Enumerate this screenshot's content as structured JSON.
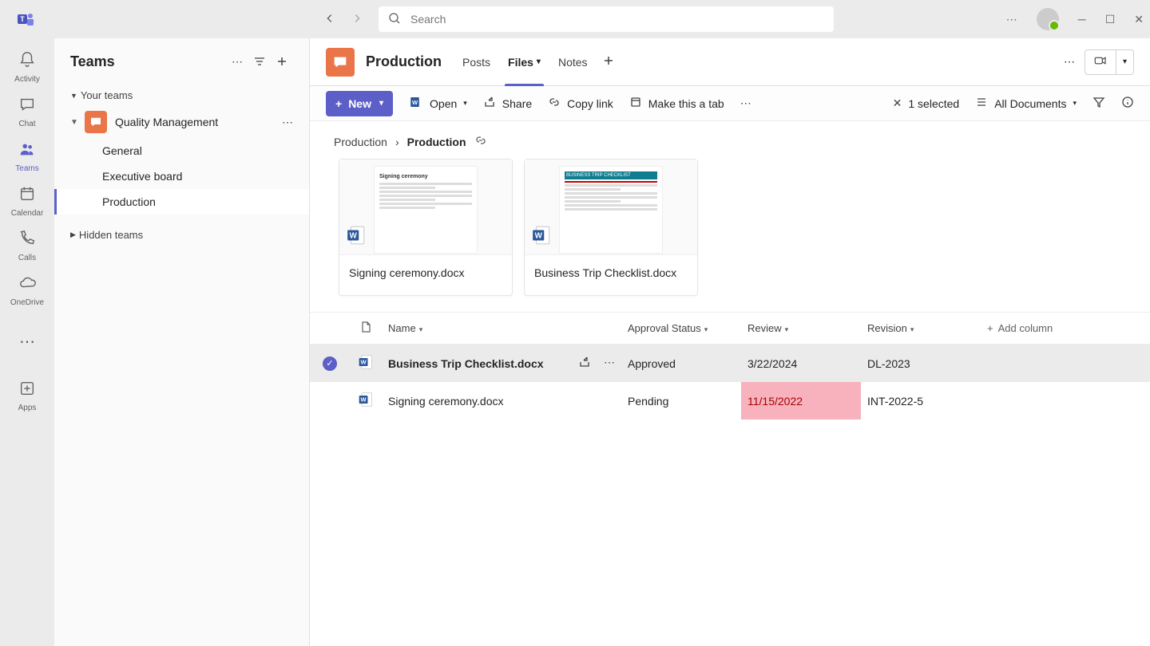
{
  "search_placeholder": "Search",
  "app_rail": [
    {
      "id": "activity",
      "label": "Activity"
    },
    {
      "id": "chat",
      "label": "Chat"
    },
    {
      "id": "teams",
      "label": "Teams",
      "active": true
    },
    {
      "id": "calendar",
      "label": "Calendar"
    },
    {
      "id": "calls",
      "label": "Calls"
    },
    {
      "id": "onedrive",
      "label": "OneDrive"
    },
    {
      "id": "apps",
      "label": "Apps"
    }
  ],
  "teams_panel": {
    "title": "Teams",
    "your_teams_label": "Your teams",
    "hidden_teams_label": "Hidden teams",
    "team_name": "Quality Management",
    "channels": [
      {
        "label": "General"
      },
      {
        "label": "Executive board"
      },
      {
        "label": "Production",
        "active": true
      }
    ]
  },
  "channel_header": {
    "title": "Production",
    "tabs": [
      {
        "label": "Posts"
      },
      {
        "label": "Files",
        "active": true,
        "dropdown": true
      },
      {
        "label": "Notes"
      }
    ]
  },
  "toolbar": {
    "new_label": "New",
    "open_label": "Open",
    "share_label": "Share",
    "copy_link_label": "Copy link",
    "make_tab_label": "Make this a tab",
    "selected_label": "1 selected",
    "view_label": "All Documents"
  },
  "breadcrumb": {
    "root": "Production",
    "current": "Production"
  },
  "cards": [
    {
      "name": "Signing ceremony.docx",
      "preview_title": "Signing ceremony"
    },
    {
      "name": "Business Trip Checklist.docx",
      "preview_title": "BUSINESS TRIP CHECKLIST"
    }
  ],
  "table": {
    "headers": {
      "name": "Name",
      "approval": "Approval Status",
      "review": "Review",
      "revision": "Revision",
      "add_column": "Add column"
    },
    "rows": [
      {
        "name": "Business Trip Checklist.docx",
        "approval": "Approved",
        "review": "3/22/2024",
        "revision": "DL-2023",
        "selected": true,
        "review_highlight": false
      },
      {
        "name": "Signing ceremony.docx",
        "approval": "Pending",
        "review": "11/15/2022",
        "revision": "INT-2022-5",
        "selected": false,
        "review_highlight": true
      }
    ]
  }
}
